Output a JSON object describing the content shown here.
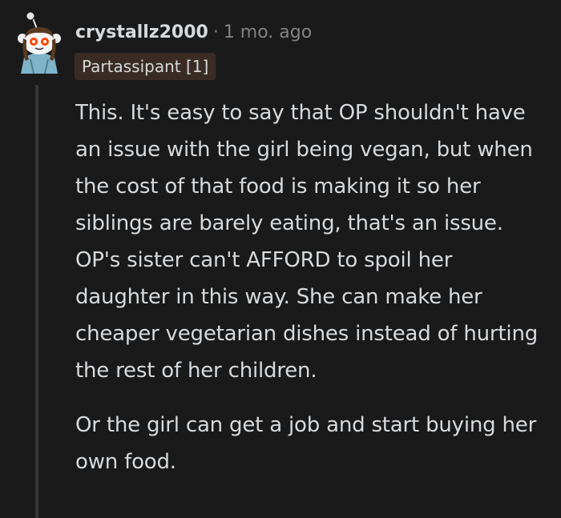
{
  "comment": {
    "username": "crystallz2000",
    "separator": "·",
    "timestamp": "1 mo. ago",
    "flair": "Partassipant [1]",
    "paragraphs": [
      "This. It's easy to say that OP shouldn't have an issue with the girl being vegan, but when the cost of that food is making it so her siblings are barely eating, that's an issue. OP's sister can't AFFORD to spoil her daughter in this way. She can make her cheaper vegetarian dishes instead of hurting the rest of her children.",
      "Or the girl can get a job and start buying her own food."
    ]
  },
  "colors": {
    "background": "#1a1a1b",
    "text": "#d7dadc",
    "meta_text": "#818384",
    "flair_background": "#3a2c25",
    "thread_line": "#343536",
    "avatar_accent": "#ff4500"
  },
  "icons": {
    "avatar": "reddit-snoo-avatar-icon"
  }
}
